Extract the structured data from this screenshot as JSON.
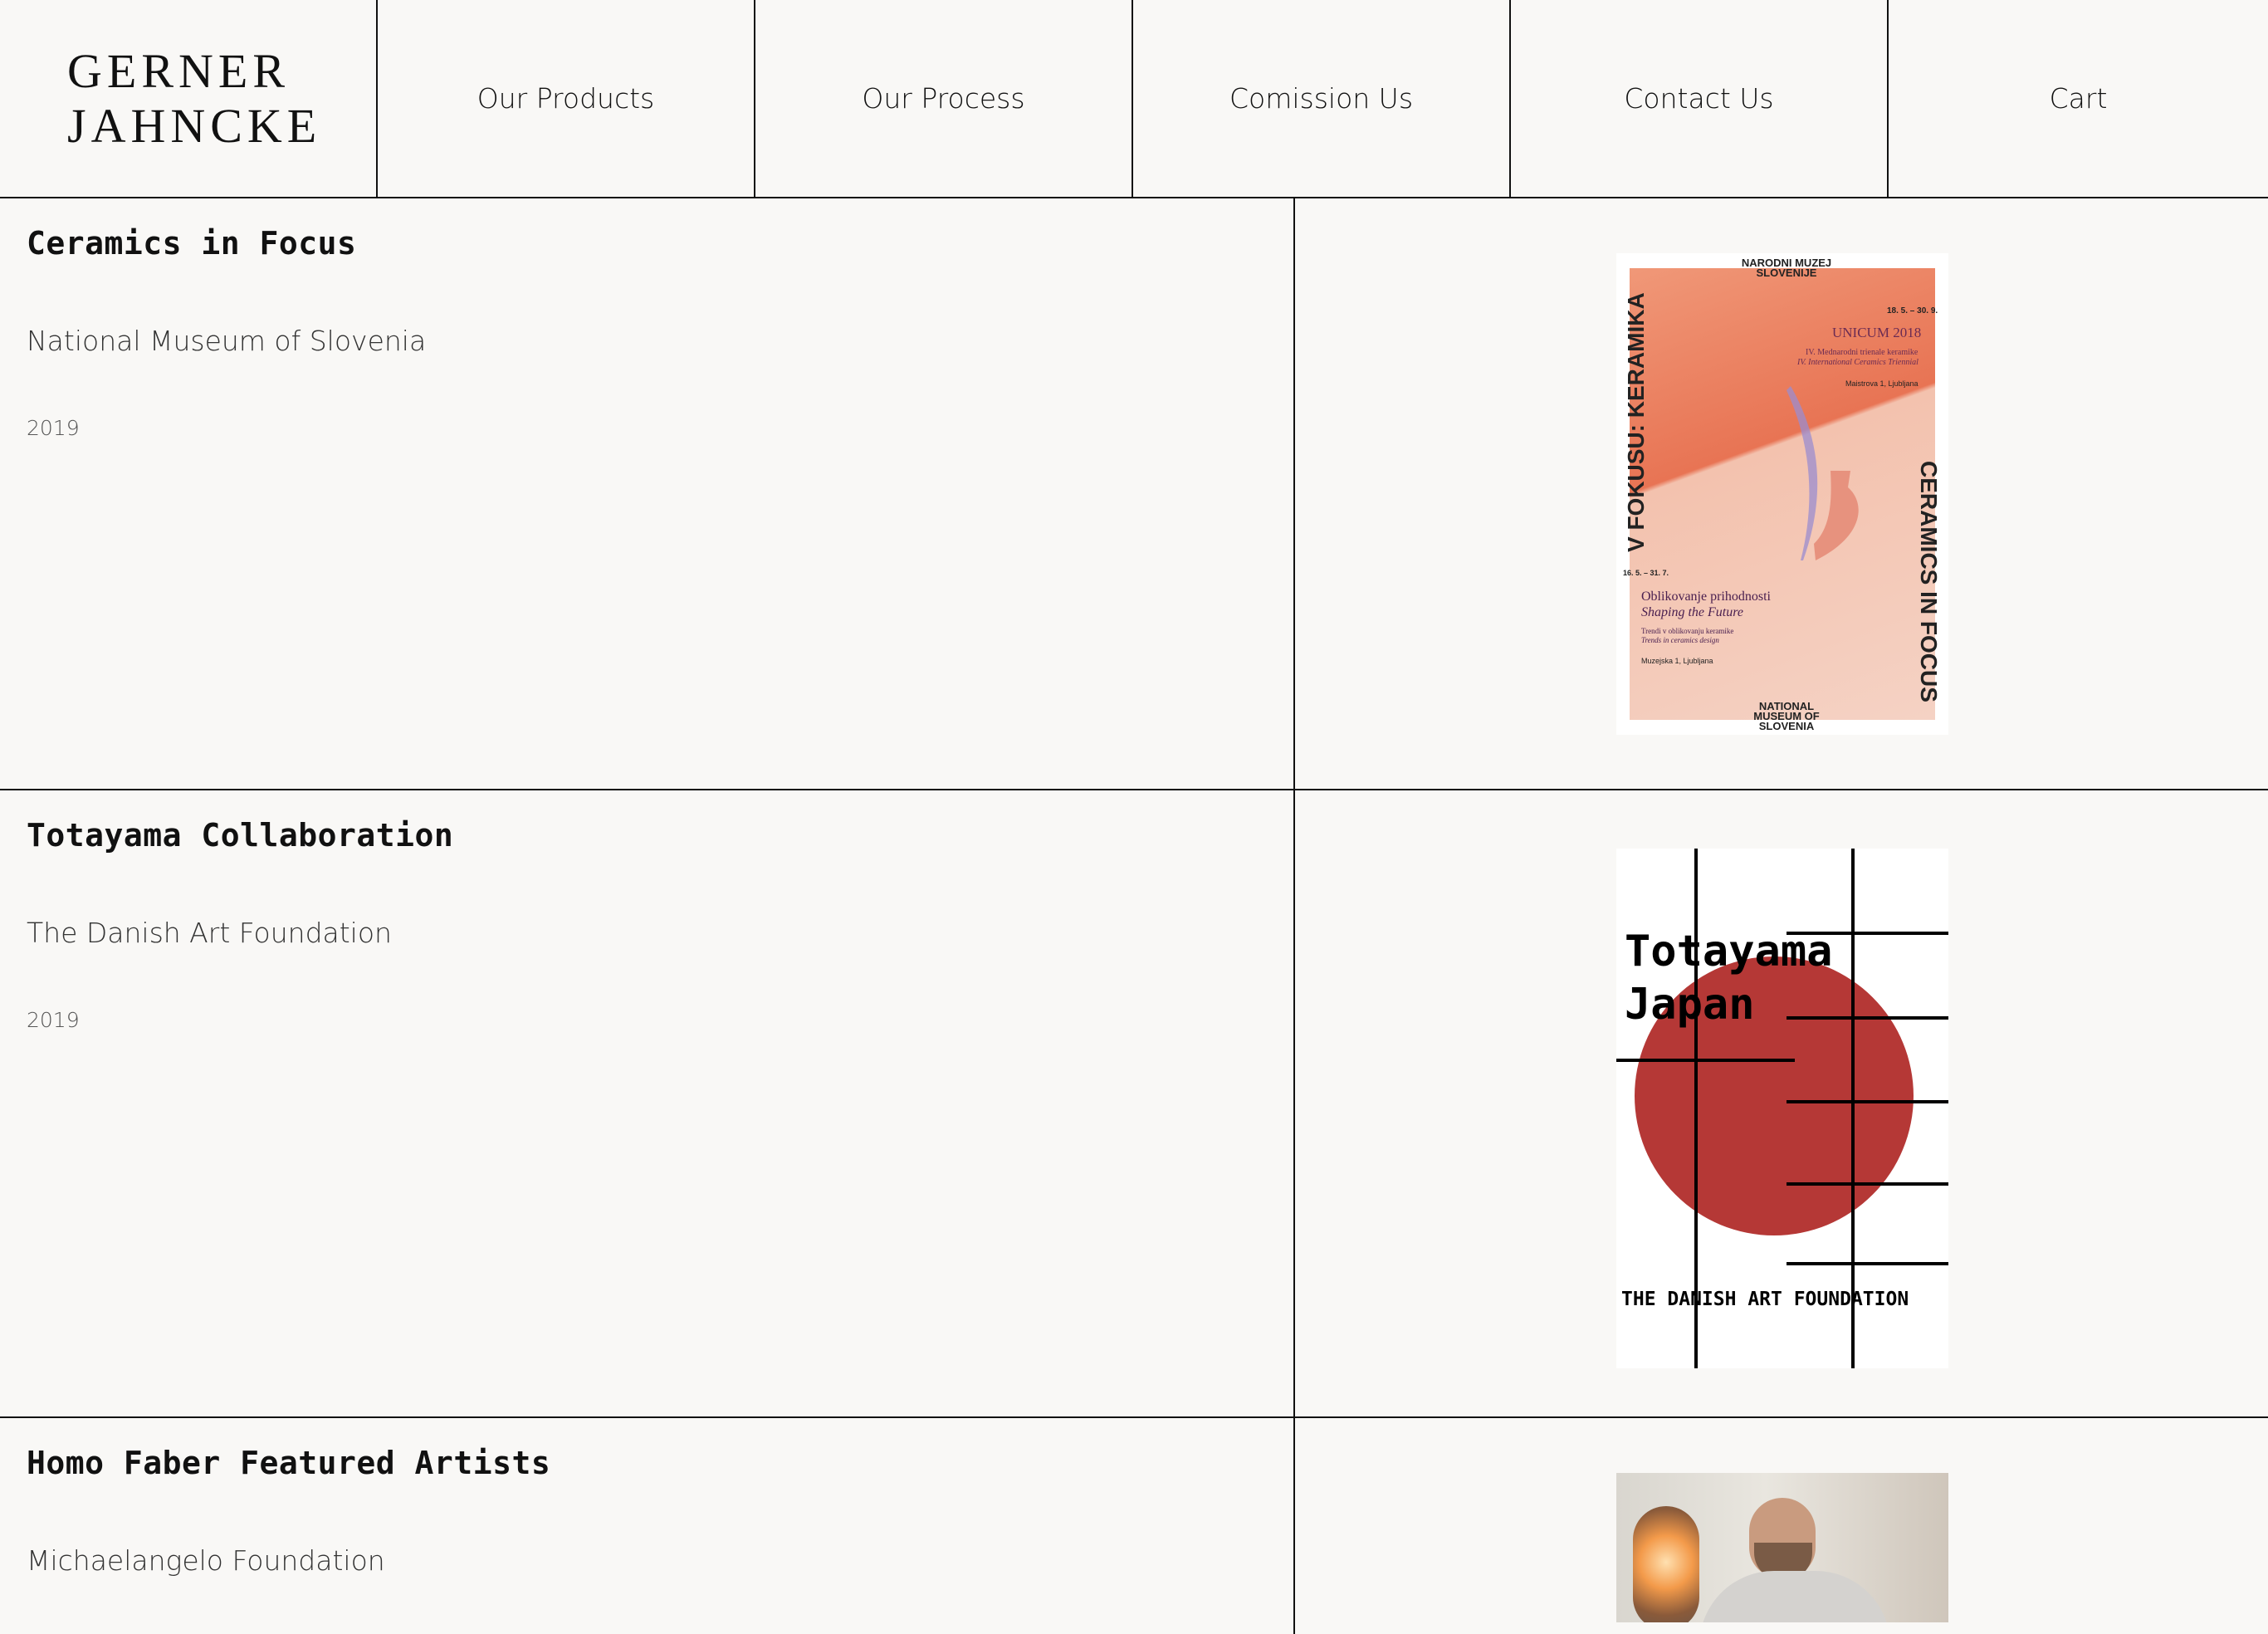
{
  "brand": {
    "line1": "GERNER",
    "line2": "JAHNCKE"
  },
  "nav": [
    {
      "label": "Our Products"
    },
    {
      "label": "Our Process"
    },
    {
      "label": "Comission Us"
    },
    {
      "label": "Contact Us"
    },
    {
      "label": "Cart"
    }
  ],
  "projects": [
    {
      "title": "Ceramics in Focus",
      "client": "National Museum of Slovenia",
      "year": "2019",
      "poster": {
        "top_label": "NARODNI MUZEJ SLOVENIJE",
        "left_vertical": "V FOKUSU: KERAMIKA",
        "right_vertical": "CERAMICS IN FOCUS",
        "dates_top": "18. 5. – 30. 9.",
        "event": "UNICUM 2018",
        "event_sub1": "IV. Mednarodni trienale keramike",
        "event_sub2": "IV. International Ceramics Triennial",
        "address1": "Maistrova 1, Ljubljana",
        "dates_mid": "16. 5. – 31. 7.",
        "shaping1": "Oblikovanje prihodnosti",
        "shaping2": "Shaping the Future",
        "trends1": "Trendi v oblikovanju keramike",
        "trends2": "Trends in ceramics design",
        "address2": "Muzejska 1, Ljubljana",
        "bottom_label": "NATIONAL MUSEUM OF SLOVENIA"
      }
    },
    {
      "title": "Totayama Collaboration",
      "client": "The Danish Art Foundation",
      "year": "2019",
      "poster": {
        "line1": "Totayama",
        "line2": "Japan",
        "footer": "THE DANISH ART FOUNDATION",
        "circle_color": "#b53836"
      }
    },
    {
      "title": "Homo Faber Featured Artists",
      "client": "Michaelangelo Foundation",
      "year": "",
      "poster": {}
    }
  ]
}
